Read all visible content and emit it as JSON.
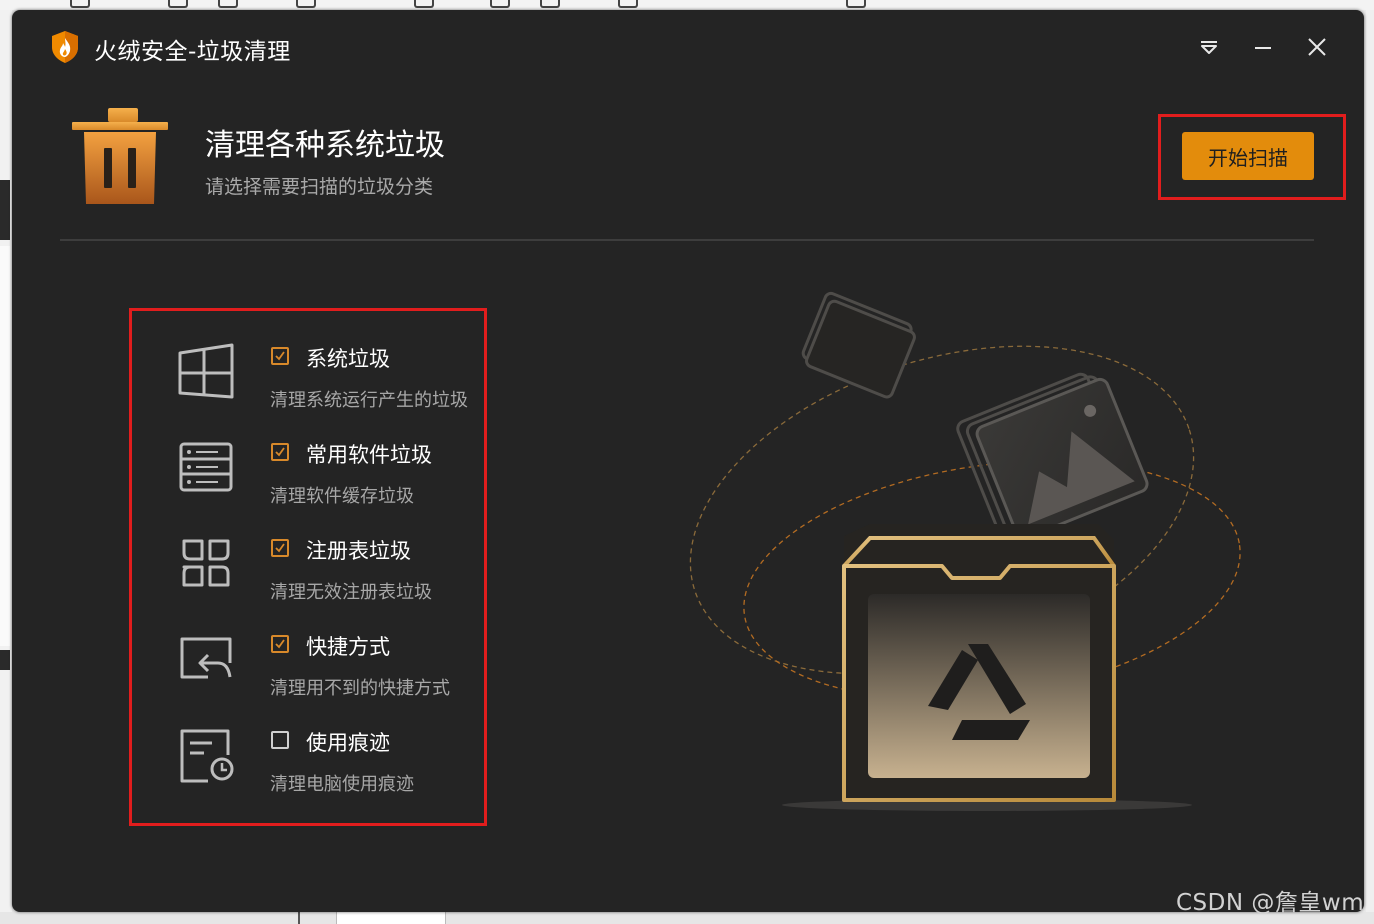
{
  "window": {
    "title": "火绒安全-垃圾清理"
  },
  "header": {
    "title": "清理各种系统垃圾",
    "subtitle": "请选择需要扫描的垃圾分类",
    "scan_button": "开始扫描"
  },
  "options": [
    {
      "label": "系统垃圾",
      "description": "清理系统运行产生的垃圾",
      "checked": true,
      "icon": "windows-icon"
    },
    {
      "label": "常用软件垃圾",
      "description": "清理软件缓存垃圾",
      "checked": true,
      "icon": "server-list-icon"
    },
    {
      "label": "注册表垃圾",
      "description": "清理无效注册表垃圾",
      "checked": true,
      "icon": "registry-grid-icon"
    },
    {
      "label": "快捷方式",
      "description": "清理用不到的快捷方式",
      "checked": true,
      "icon": "shortcut-icon"
    },
    {
      "label": "使用痕迹",
      "description": "清理电脑使用痕迹",
      "checked": false,
      "icon": "history-document-icon"
    }
  ],
  "watermark": "CSDN @詹皇wm",
  "colors": {
    "accent": "#e38c0c",
    "window_bg": "#242424",
    "highlight_box": "#e11d1d"
  }
}
